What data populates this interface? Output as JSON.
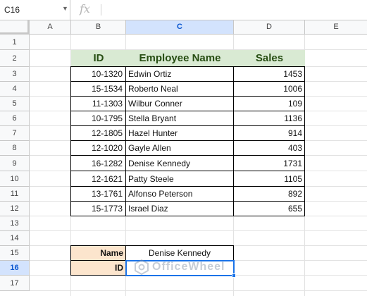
{
  "name_box": {
    "value": "C16"
  },
  "formula_bar": {
    "fx_label": "fx",
    "value": ""
  },
  "columns": [
    "A",
    "B",
    "C",
    "D",
    "E"
  ],
  "selected_column": "C",
  "rows": [
    "1",
    "2",
    "3",
    "4",
    "5",
    "6",
    "7",
    "8",
    "9",
    "10",
    "11",
    "12",
    "13",
    "14",
    "15",
    "16",
    "17"
  ],
  "selected_row": "16",
  "table": {
    "headers": {
      "id": "ID",
      "name": "Employee Name",
      "sales": "Sales"
    },
    "rows": [
      {
        "id": "10-1320",
        "name": "Edwin Ortiz",
        "sales": "1453"
      },
      {
        "id": "15-1534",
        "name": "Roberto Neal",
        "sales": "1006"
      },
      {
        "id": "11-1303",
        "name": "Wilbur Conner",
        "sales": "109"
      },
      {
        "id": "10-1795",
        "name": "Stella Bryant",
        "sales": "1136"
      },
      {
        "id": "12-1805",
        "name": "Hazel Hunter",
        "sales": "914"
      },
      {
        "id": "12-1020",
        "name": "Gayle Allen",
        "sales": "403"
      },
      {
        "id": "16-1282",
        "name": "Denise Kennedy",
        "sales": "1731"
      },
      {
        "id": "12-1621",
        "name": "Patty Steele",
        "sales": "1105"
      },
      {
        "id": "13-1761",
        "name": "Alfonso Peterson",
        "sales": "892"
      },
      {
        "id": "15-1773",
        "name": "Israel Diaz",
        "sales": "655"
      }
    ]
  },
  "lookup": {
    "name_label": "Name",
    "name_value": "Denise Kennedy",
    "id_label": "ID",
    "id_value": ""
  },
  "watermark": {
    "text": "OfficeWheel"
  },
  "colors": {
    "header_fill": "#d9ead3",
    "header_text": "#274e13",
    "lookup_fill": "#fce5cd",
    "selection": "#1a73e8"
  }
}
